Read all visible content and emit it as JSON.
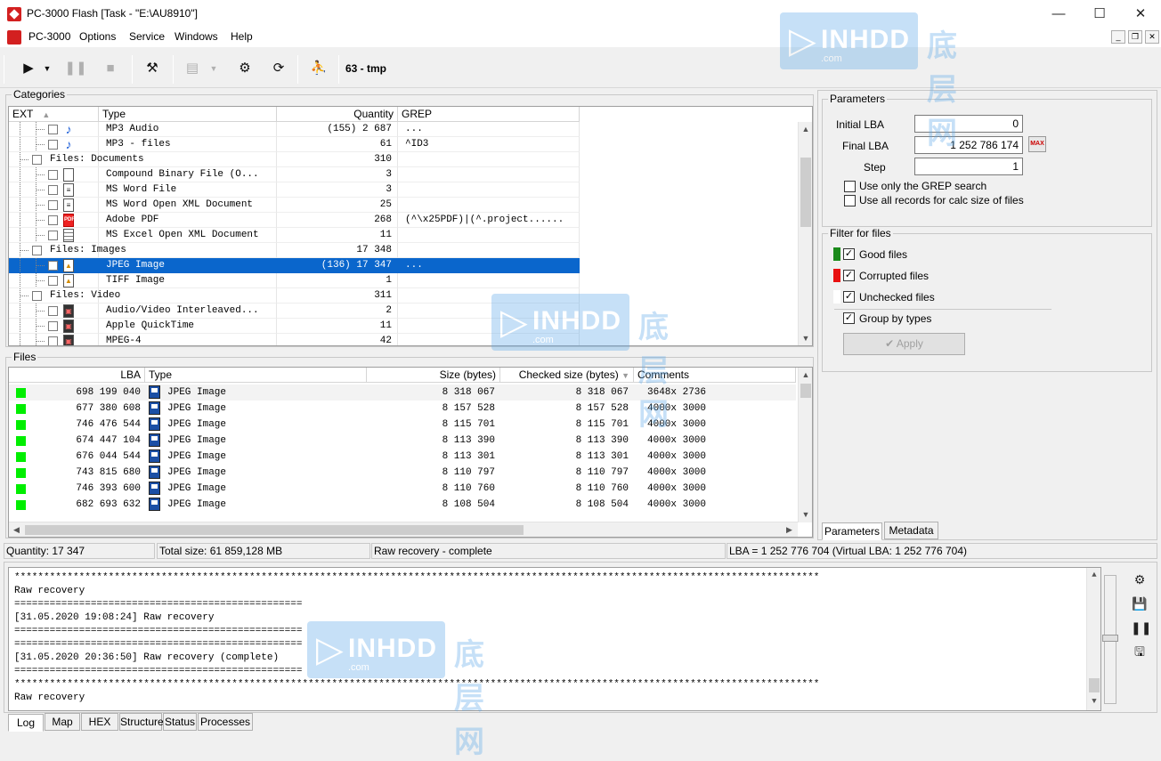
{
  "window": {
    "title": "PC-3000 Flash [Task - \"E:\\AU8910\"]",
    "min": "—",
    "max": "☐",
    "close": "✕"
  },
  "menu": {
    "items": [
      "PC-3000",
      "Options",
      "Service",
      "Windows",
      "Help"
    ]
  },
  "toolbar": {
    "task": "63 - tmp"
  },
  "categories": {
    "label": "Categories",
    "headers": {
      "ext": "EXT",
      "type": "Type",
      "quantity": "Quantity",
      "grep": "GREP"
    },
    "rows": [
      {
        "type": "MP3 Audio",
        "quantity": "(155) 2 687",
        "grep": "...",
        "level": 2,
        "icon": "music-icon"
      },
      {
        "type": "MP3 - files",
        "quantity": "61",
        "grep": "^ID3",
        "level": 2,
        "icon": "music-icon"
      },
      {
        "type": "Files: Documents",
        "quantity": "310",
        "grep": "",
        "level": 1,
        "icon": ""
      },
      {
        "type": "Compound Binary File (O...",
        "quantity": "3",
        "grep": "",
        "level": 2,
        "icon": "file-icon"
      },
      {
        "type": "MS Word File",
        "quantity": "3",
        "grep": "",
        "level": 2,
        "icon": "document-icon"
      },
      {
        "type": "MS Word Open XML Document",
        "quantity": "25",
        "grep": "",
        "level": 2,
        "icon": "document-icon"
      },
      {
        "type": "Adobe PDF",
        "quantity": "268",
        "grep": "(^\\x25PDF)|(^.project......",
        "level": 2,
        "icon": "pdf-icon"
      },
      {
        "type": "MS Excel Open XML Document",
        "quantity": "11",
        "grep": "",
        "level": 2,
        "icon": "spreadsheet-icon"
      },
      {
        "type": "Files: Images",
        "quantity": "17 348",
        "grep": "",
        "level": 1,
        "icon": ""
      },
      {
        "type": "JPEG Image",
        "quantity": "(136) 17 347",
        "grep": "...",
        "level": 2,
        "icon": "image-icon",
        "selected": true
      },
      {
        "type": "TIFF Image",
        "quantity": "1",
        "grep": "",
        "level": 2,
        "icon": "image-icon"
      },
      {
        "type": "Files: Video",
        "quantity": "311",
        "grep": "",
        "level": 1,
        "icon": ""
      },
      {
        "type": "Audio/Video Interleaved...",
        "quantity": "2",
        "grep": "",
        "level": 2,
        "icon": "video-icon"
      },
      {
        "type": "Apple QuickTime",
        "quantity": "11",
        "grep": "",
        "level": 2,
        "icon": "video-icon"
      },
      {
        "type": "MPEG-4",
        "quantity": "42",
        "grep": "",
        "level": 2,
        "icon": "video-icon"
      }
    ]
  },
  "files": {
    "label": "Files",
    "headers": {
      "lba": "LBA",
      "type": "Type",
      "size": "Size (bytes)",
      "checked": "Checked size (bytes)",
      "comments": "Comments"
    },
    "rows": [
      {
        "lba": "698 199 040",
        "type": "JPEG Image",
        "size": "8 318 067",
        "checked": "8 318 067",
        "comments": "3648x 2736"
      },
      {
        "lba": "677 380 608",
        "type": "JPEG Image",
        "size": "8 157 528",
        "checked": "8 157 528",
        "comments": "4000x 3000"
      },
      {
        "lba": "746 476 544",
        "type": "JPEG Image",
        "size": "8 115 701",
        "checked": "8 115 701",
        "comments": "4000x 3000"
      },
      {
        "lba": "674 447 104",
        "type": "JPEG Image",
        "size": "8 113 390",
        "checked": "8 113 390",
        "comments": "4000x 3000"
      },
      {
        "lba": "676 044 544",
        "type": "JPEG Image",
        "size": "8 113 301",
        "checked": "8 113 301",
        "comments": "4000x 3000"
      },
      {
        "lba": "743 815 680",
        "type": "JPEG Image",
        "size": "8 110 797",
        "checked": "8 110 797",
        "comments": "4000x 3000"
      },
      {
        "lba": "746 393 600",
        "type": "JPEG Image",
        "size": "8 110 760",
        "checked": "8 110 760",
        "comments": "4000x 3000"
      },
      {
        "lba": "682 693 632",
        "type": "JPEG Image",
        "size": "8 108 504",
        "checked": "8 108 504",
        "comments": "4000x 3000"
      }
    ]
  },
  "parameters": {
    "label": "Parameters",
    "initial_lba_label": "Initial LBA",
    "initial_lba": "0",
    "final_lba_label": "Final  LBA",
    "final_lba": "1 252 786 174",
    "step_label": "Step",
    "step": "1",
    "max_label": "MAX",
    "grep_only": "Use only the GREP search",
    "all_records": "Use all records for calc size of files"
  },
  "filter": {
    "label": "Filter for files",
    "good": "Good files",
    "corrupted": "Corrupted files",
    "unchecked": "Unchecked files",
    "group": "Group by types",
    "apply": "Apply",
    "colors": {
      "good": "#1a8a1a",
      "corrupted": "#e81010",
      "unchecked": "#ffffff"
    }
  },
  "right_tabs": [
    "Parameters",
    "Metadata"
  ],
  "status": {
    "quantity": "Quantity: 17 347",
    "total": "Total size: 61 859,128 MB",
    "state": "Raw recovery - complete",
    "lba": "LBA = 1 252 776 704 (Virtual LBA: 1 252 776 704)"
  },
  "log": {
    "lines": [
      "*****************************************************************************************************************************************",
      "Raw recovery",
      "=================================================",
      "[31.05.2020 19:08:24] Raw recovery",
      "=================================================",
      "=================================================",
      "[31.05.2020 20:36:50] Raw recovery (complete)",
      "=================================================",
      "*****************************************************************************************************************************************",
      "Raw recovery"
    ]
  },
  "bottom_tabs": [
    "Log",
    "Map",
    "HEX",
    "Structure",
    "Status",
    "Processes"
  ],
  "watermark": {
    "en": "INHDD",
    "cn": "底层网",
    "com": ".com"
  }
}
